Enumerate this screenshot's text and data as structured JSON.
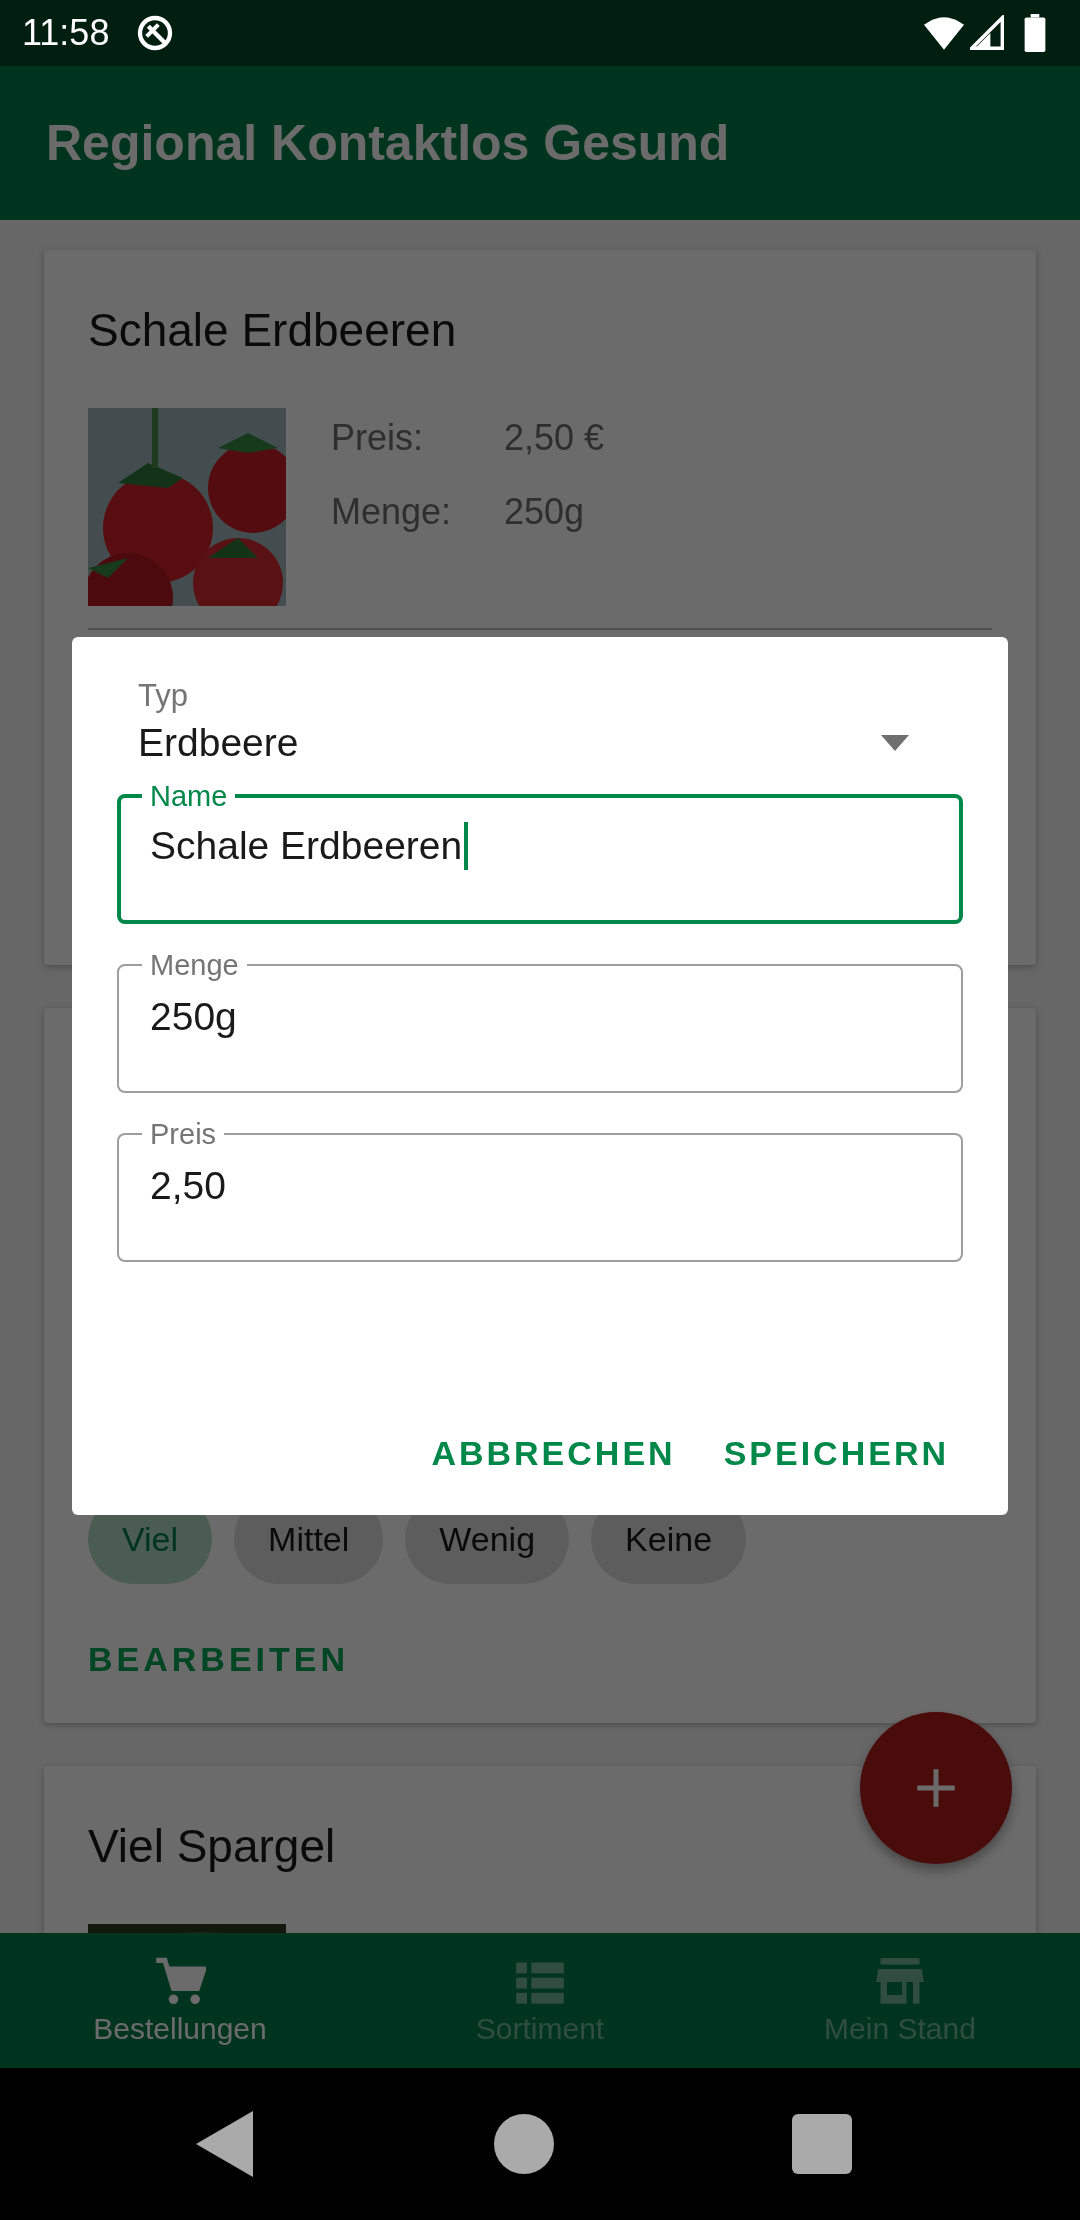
{
  "status_bar": {
    "time": "11:58"
  },
  "app_bar": {
    "title": "Regional Kontaktlos Gesund"
  },
  "cards": [
    {
      "title": "Schale Erdbeeren",
      "image": {
        "kind": "picture"
      },
      "details": [
        {
          "label": "Preis:",
          "value": "2,50 €"
        },
        {
          "label": "Menge:",
          "value": "250g"
        }
      ]
    },
    {
      "chips": [
        {
          "label": "Viel",
          "selected": true
        },
        {
          "label": "Mittel",
          "selected": false
        },
        {
          "label": "Wenig",
          "selected": false
        },
        {
          "label": "Keine",
          "selected": false
        }
      ],
      "action": "BEARBEITEN"
    },
    {
      "title": "Viel Spargel",
      "image": {
        "kind": "picture"
      }
    }
  ],
  "bottom_nav": [
    {
      "label": "Bestellungen",
      "selected": true
    },
    {
      "label": "Sortiment",
      "selected": false
    },
    {
      "label": "Mein Stand",
      "selected": false
    }
  ],
  "dialog": {
    "type_field": {
      "label": "Typ",
      "value": "Erdbeere"
    },
    "fields": [
      {
        "label": "Name",
        "value": "Schale Erdbeeren",
        "focused": true
      },
      {
        "label": "Menge",
        "value": "250g",
        "focused": false
      },
      {
        "label": "Preis",
        "value": "2,50",
        "focused": false
      }
    ],
    "buttons": [
      "ABBRECHEN",
      "SPEICHERN"
    ]
  }
}
